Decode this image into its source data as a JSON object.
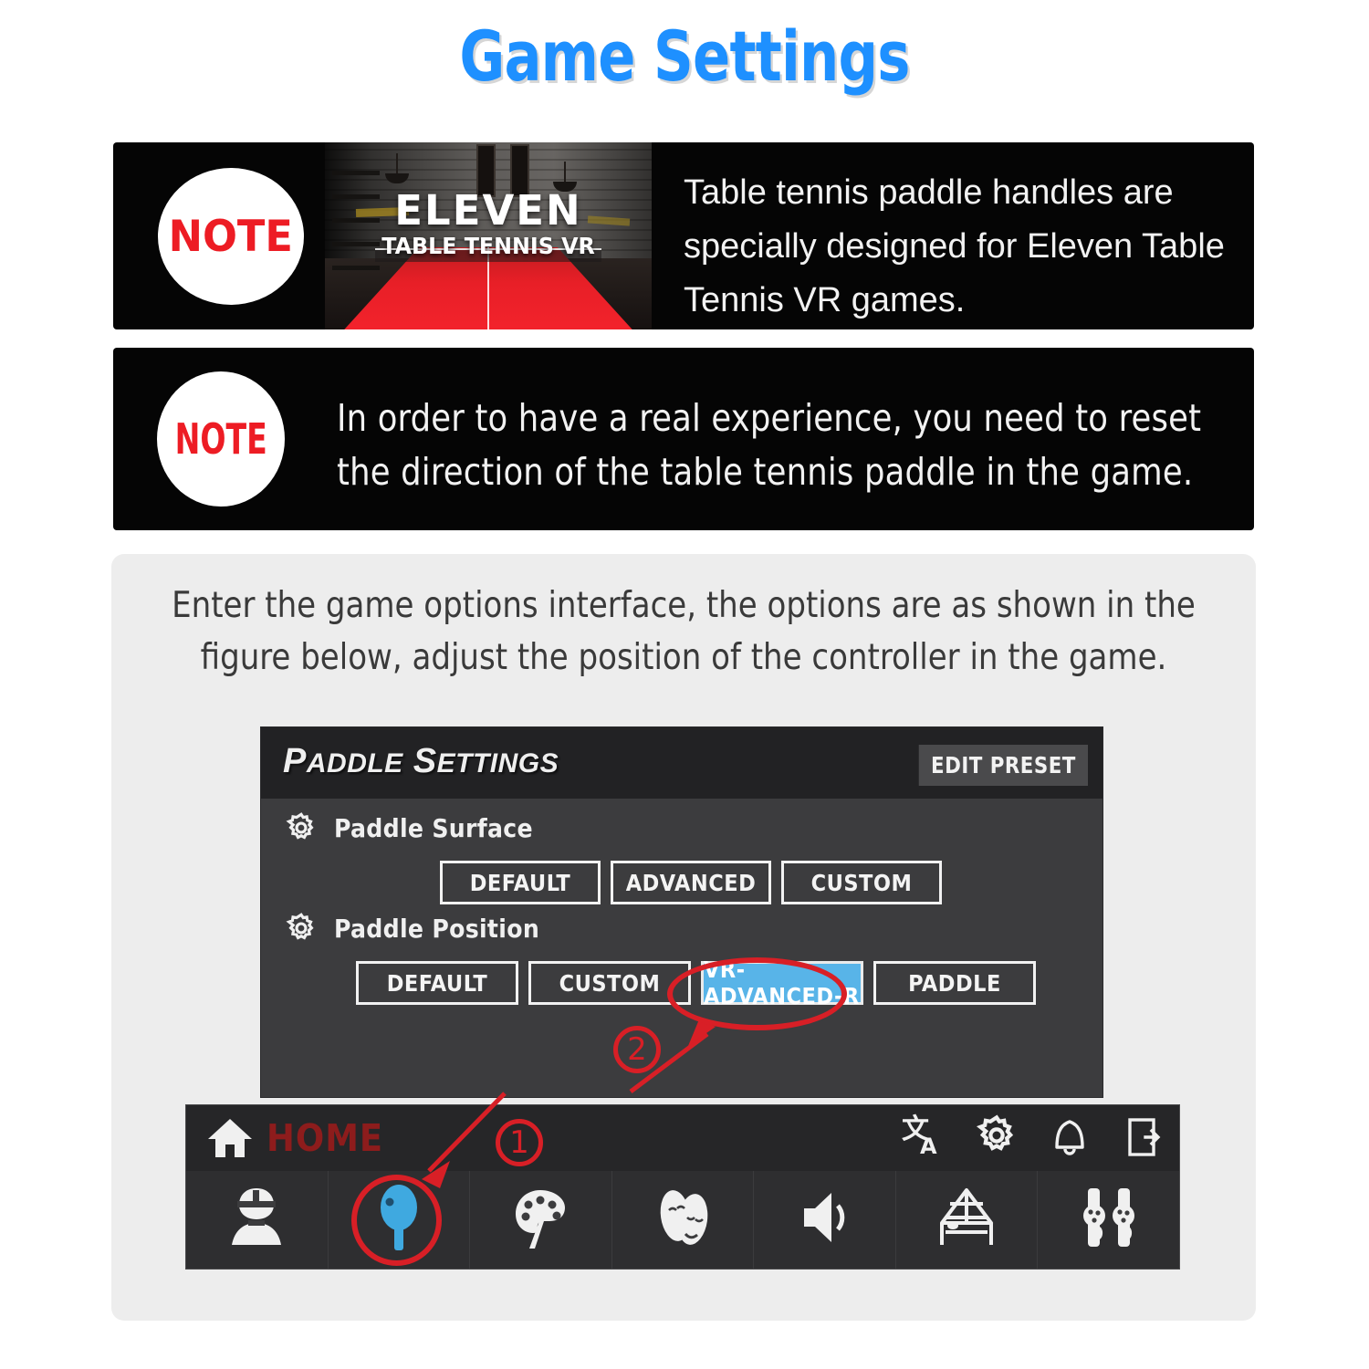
{
  "title": "Game Settings",
  "notes": [
    {
      "badge": "NOTE",
      "thumbnail": {
        "logo_main": "ELEVEN",
        "logo_sub": "TABLE TENNIS VR"
      },
      "text": "Table tennis paddle handles are specially designed for Eleven Table Tennis VR games."
    },
    {
      "badge": "NOTE",
      "text": "In order to have a real experience, you need to reset the direction of the table tennis paddle in the game."
    }
  ],
  "figure": {
    "intro_text": "Enter the game options interface, the options are as shown in the figure below, adjust the position of the controller in the game.",
    "settings_panel": {
      "title_first": "P",
      "title_first_rest": "ADDLE",
      "title_second": "S",
      "title_second_rest": "ETTINGS",
      "edit_preset_label": "EDIT PRESET",
      "rows": [
        {
          "label": "Paddle Surface",
          "icon": "gear-icon",
          "options": [
            "DEFAULT",
            "ADVANCED",
            "CUSTOM"
          ],
          "selected": null
        },
        {
          "label": "Paddle Position",
          "icon": "gear-icon",
          "options": [
            "DEFAULT",
            "CUSTOM",
            "VR-ADVANCED-R",
            "PADDLE"
          ],
          "selected": "VR-ADVANCED-R"
        }
      ]
    },
    "navbar": {
      "home_label": "HOME",
      "home_icon": "house-icon",
      "top_icons": [
        "translate-icon",
        "gear-icon",
        "bell-icon",
        "exit-icon"
      ],
      "bottom_icons": [
        "player-avatar-icon",
        "paddle-icon",
        "palette-icon",
        "theater-masks-icon",
        "speaker-icon",
        "table-tennis-table-icon",
        "vr-controllers-icon"
      ],
      "selected_bottom_icon": "paddle-icon"
    },
    "annotations": [
      {
        "marker": "①",
        "target": "paddle-icon"
      },
      {
        "marker": "②",
        "target": "VR-ADVANCED-R"
      }
    ]
  },
  "colors": {
    "title_blue": "#1E90FF",
    "note_red": "#ED1C24",
    "annotation_red": "#d81f26",
    "selected_blue": "#58b4e8",
    "home_red": "#8d1c1c",
    "panel_gray": "#ededed"
  }
}
